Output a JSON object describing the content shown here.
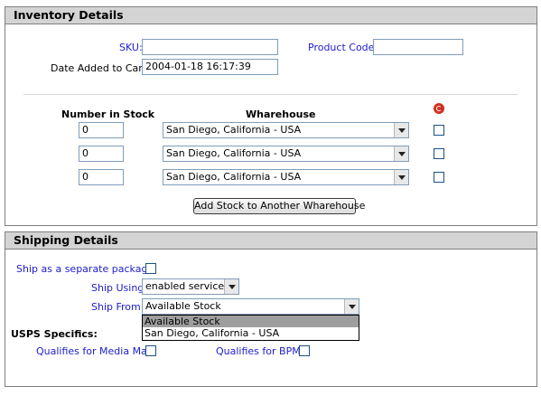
{
  "inventory": {
    "title": "Inventory Details",
    "sku_label": "SKU:",
    "sku_value": "",
    "product_code_label": "Product Code:",
    "product_code_value": "",
    "date_added_label": "Date Added to Cart:",
    "date_added_value": "2004-01-18 16:17:39",
    "col_number_in_stock": "Number in Stock",
    "col_warehouse": "Wharehouse",
    "rows": [
      {
        "stock": "0",
        "warehouse": "San Diego, California - USA"
      },
      {
        "stock": "0",
        "warehouse": "San Diego, California - USA"
      },
      {
        "stock": "0",
        "warehouse": "San Diego, California - USA"
      }
    ],
    "add_stock_button": "Add Stock to Another Wharehouse"
  },
  "shipping": {
    "title": "Shipping Details",
    "separate_package_label": "Ship as a separate package:",
    "ship_using_label": "Ship Using:",
    "ship_using_value": "enabled services",
    "ship_from_label": "Ship From:",
    "ship_from_value": "Available Stock",
    "ship_from_options": [
      "Available Stock",
      "San Diego, California - USA"
    ],
    "usps_heading": "USPS Specifics:",
    "media_mail_label": "Qualifies for Media Mail:",
    "bpm_label": "Qualifies for BPM:"
  },
  "colors": {
    "label_blue": "#1c1ccc",
    "header_gray": "#d4d4d4",
    "delete_icon_red": "#d03020"
  }
}
